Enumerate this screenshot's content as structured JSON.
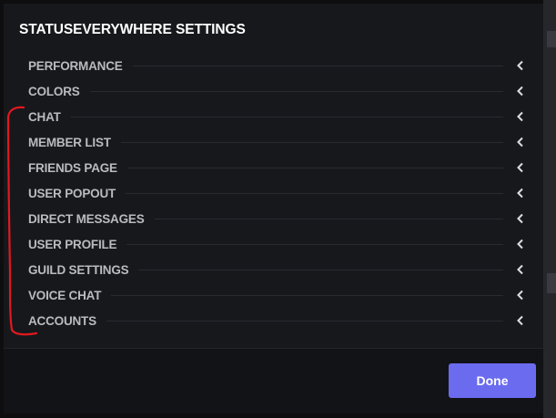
{
  "modal": {
    "title": "STATUSEVERYWHERE SETTINGS",
    "sections": [
      {
        "label": "PERFORMANCE"
      },
      {
        "label": "COLORS"
      },
      {
        "label": "CHAT"
      },
      {
        "label": "MEMBER LIST"
      },
      {
        "label": "FRIENDS PAGE"
      },
      {
        "label": "USER POPOUT"
      },
      {
        "label": "DIRECT MESSAGES"
      },
      {
        "label": "USER PROFILE"
      },
      {
        "label": "GUILD SETTINGS"
      },
      {
        "label": "VOICE CHAT"
      },
      {
        "label": "ACCOUNTS"
      }
    ],
    "section_icon": "chevron-left-icon",
    "done_label": "Done"
  },
  "colors": {
    "accent": "#6b6bf0",
    "annotation": "#e0191f",
    "background": "#17181c",
    "label": "#b9bbbe"
  }
}
